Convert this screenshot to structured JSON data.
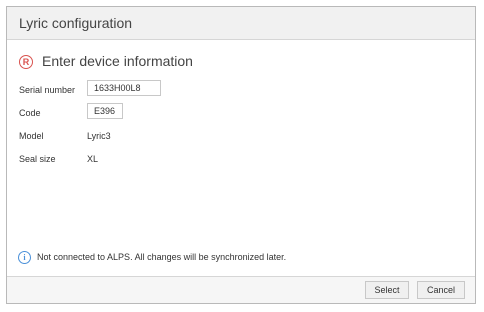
{
  "dialog": {
    "title": "Lyric configuration",
    "section_title": "Enter device information",
    "section_icon": "registered-r-icon"
  },
  "fields": {
    "serial_number": {
      "label": "Serial number",
      "value": "1633H00L8"
    },
    "code": {
      "label": "Code",
      "value": "E396"
    },
    "model": {
      "label": "Model",
      "value": "Lyric3"
    },
    "seal_size": {
      "label": "Seal size",
      "value": "XL"
    }
  },
  "info": {
    "icon": "info-icon",
    "message": "Not connected to ALPS. All changes will be synchronized later."
  },
  "buttons": {
    "select": "Select",
    "cancel": "Cancel"
  },
  "colors": {
    "accent_red": "#d9534f",
    "info_blue": "#4a90d9"
  }
}
